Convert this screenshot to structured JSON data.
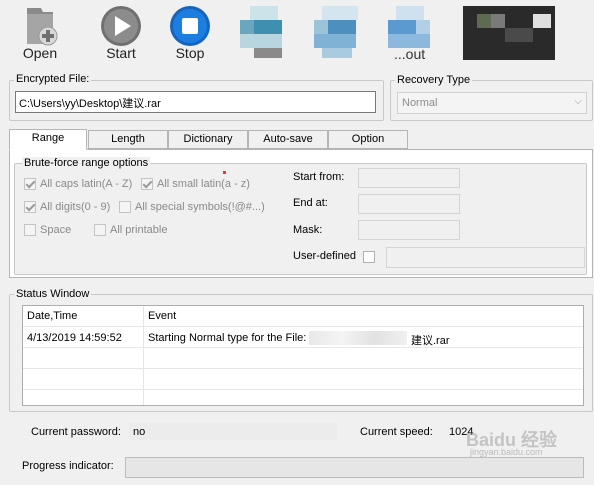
{
  "toolbar": {
    "open_label": "Open",
    "start_label": "Start",
    "stop_label": "Stop",
    "partial_label": "...out"
  },
  "encrypted_file": {
    "label": "Encrypted File:",
    "path": "C:\\Users\\yy\\Desktop\\建议.rar"
  },
  "recovery_type": {
    "label": "Recovery Type",
    "value": "Normal"
  },
  "tabs": [
    {
      "label": "Range",
      "active": true
    },
    {
      "label": "Length"
    },
    {
      "label": "Dictionary"
    },
    {
      "label": "Auto-save"
    },
    {
      "label": "Option"
    }
  ],
  "range": {
    "group_title": "Brute-force range options",
    "options": {
      "caps": {
        "label": "All caps latin(A - Z)",
        "checked": true
      },
      "small": {
        "label": "All small latin(a - z)",
        "checked": true
      },
      "digits": {
        "label": "All digits(0 - 9)",
        "checked": true
      },
      "special": {
        "label": "All special symbols(!@#...)",
        "checked": false
      },
      "space": {
        "label": "Space",
        "checked": false
      },
      "printable": {
        "label": "All printable",
        "checked": false
      }
    },
    "start_from_label": "Start from:",
    "end_at_label": "End at:",
    "mask_label": "Mask:",
    "user_defined_label": "User-defined"
  },
  "status": {
    "group_title": "Status Window",
    "columns": [
      "Date,Time",
      "Event"
    ],
    "rows": [
      {
        "datetime": "4/13/2019 14:59:52",
        "event_prefix": "Starting Normal type for the File:",
        "event_suffix": "建议.rar"
      }
    ]
  },
  "current_password": {
    "label": "Current password:",
    "value": "no"
  },
  "current_speed": {
    "label": "Current speed:",
    "value": "1024"
  },
  "progress": {
    "label": "Progress indicator:"
  },
  "watermark": {
    "text": "Baidu 经验",
    "url": "jingyan.baidu.com"
  },
  "colors": {
    "stop_button_blue": "#1c7fe0",
    "start_button_gray": "#6e6e6e",
    "disabled_text": "#8a8a8a"
  }
}
